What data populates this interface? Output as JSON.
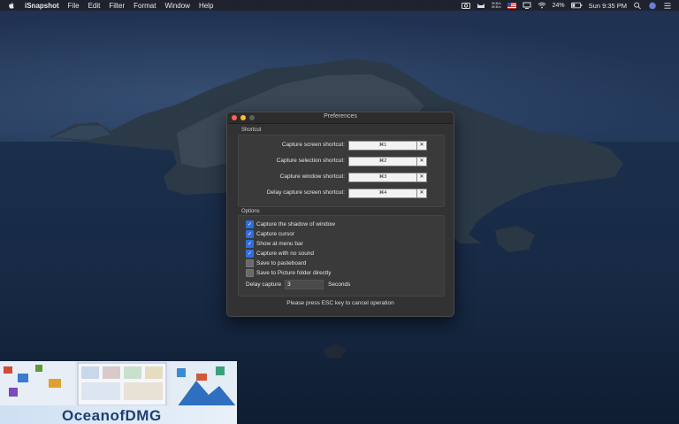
{
  "menubar": {
    "app_name": "iSnapshot",
    "menus": [
      "File",
      "Edit",
      "Filter",
      "Format",
      "Window",
      "Help"
    ],
    "net_up": "0KB/s",
    "net_down": "6KB/s",
    "battery": "24%",
    "clock": "Sun 9:35 PM"
  },
  "window": {
    "title": "Preferences",
    "shortcut_section": "Shortcut",
    "shortcuts": [
      {
        "label": "Capture screen shortcut:",
        "key": "⌘1"
      },
      {
        "label": "Capture selection shortcut:",
        "key": "⌘2"
      },
      {
        "label": "Capture window shortcut:",
        "key": "⌘3"
      },
      {
        "label": "Delay capture screen shortcut:",
        "key": "⌘4"
      }
    ],
    "clear_glyph": "✕",
    "options_section": "Options",
    "options": [
      {
        "label": "Capture the shadow of window",
        "checked": true
      },
      {
        "label": "Capture cursor",
        "checked": true
      },
      {
        "label": "Show at menu bar",
        "checked": true
      },
      {
        "label": "Capture with no sound",
        "checked": true
      },
      {
        "label": "Save to pasteboard",
        "checked": false
      },
      {
        "label": "Save to Picture folder directly",
        "checked": false
      }
    ],
    "delay_label": "Delay capture",
    "delay_value": "3",
    "seconds_label": "Seconds",
    "hint": "Please press ESC key to cancel operation"
  },
  "watermark": {
    "text": "OceanofDMG"
  },
  "colors": {
    "checkbox_on": "#2f6fe0",
    "window_bg": "#323232",
    "close": "#fe5f57",
    "minimize": "#febc2e"
  }
}
